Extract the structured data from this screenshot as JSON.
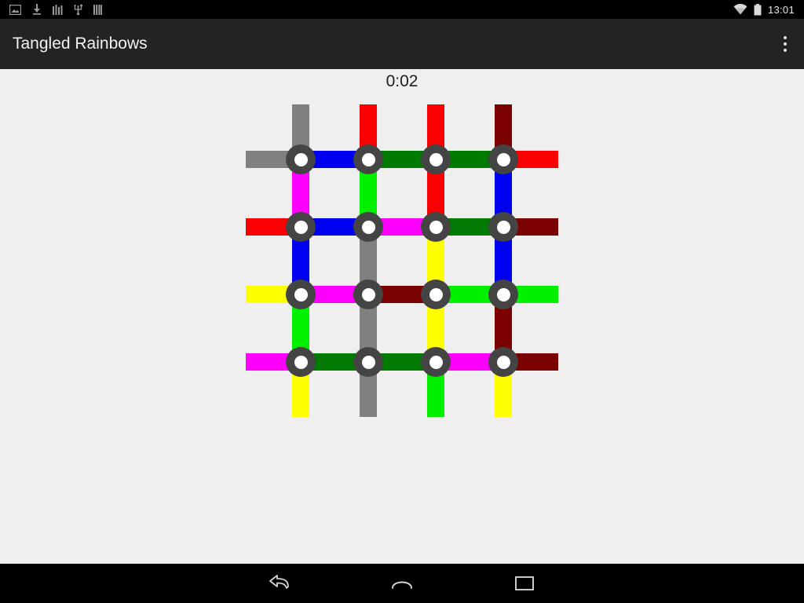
{
  "statusbar": {
    "time": "13:01",
    "left_icons": [
      "screenshot-icon",
      "download-icon",
      "equalizer-icon",
      "usb-icon",
      "bars-icon"
    ],
    "right_icons": [
      "wifi-icon",
      "battery-icon"
    ],
    "background": "#000000"
  },
  "actionbar": {
    "title": "Tangled Rainbows",
    "overflow_label": "More options",
    "background": "#232323"
  },
  "game": {
    "timer": "0:02",
    "background": "#efefef",
    "node_ring_color": "#444444",
    "node_core_color": "#ffffff",
    "grid_rows": 4,
    "grid_cols": 4,
    "palette": {
      "gray": "#808080",
      "blue": "#0000f0",
      "green": "#007a00",
      "red": "#fb0000",
      "magenta": "#ff00ff",
      "darkred": "#7b0000",
      "yellow": "#ffff00",
      "lime": "#00f000"
    },
    "horizontal_segments": [
      [
        "gray",
        "blue",
        "green",
        "green",
        "red"
      ],
      [
        "red",
        "blue",
        "magenta",
        "green",
        "darkred"
      ],
      [
        "yellow",
        "magenta",
        "darkred",
        "lime",
        "lime"
      ],
      [
        "magenta",
        "green",
        "green",
        "magenta",
        "darkred"
      ]
    ],
    "vertical_segments": [
      [
        "gray",
        "magenta",
        "blue",
        "lime",
        "yellow"
      ],
      [
        "red",
        "lime",
        "gray",
        "gray",
        "gray"
      ],
      [
        "red",
        "red",
        "yellow",
        "yellow",
        "lime"
      ],
      [
        "darkred",
        "blue",
        "blue",
        "darkred",
        "yellow"
      ]
    ]
  },
  "navbar": {
    "background": "#000000",
    "buttons": [
      "back-button",
      "home-button",
      "recents-button"
    ]
  }
}
